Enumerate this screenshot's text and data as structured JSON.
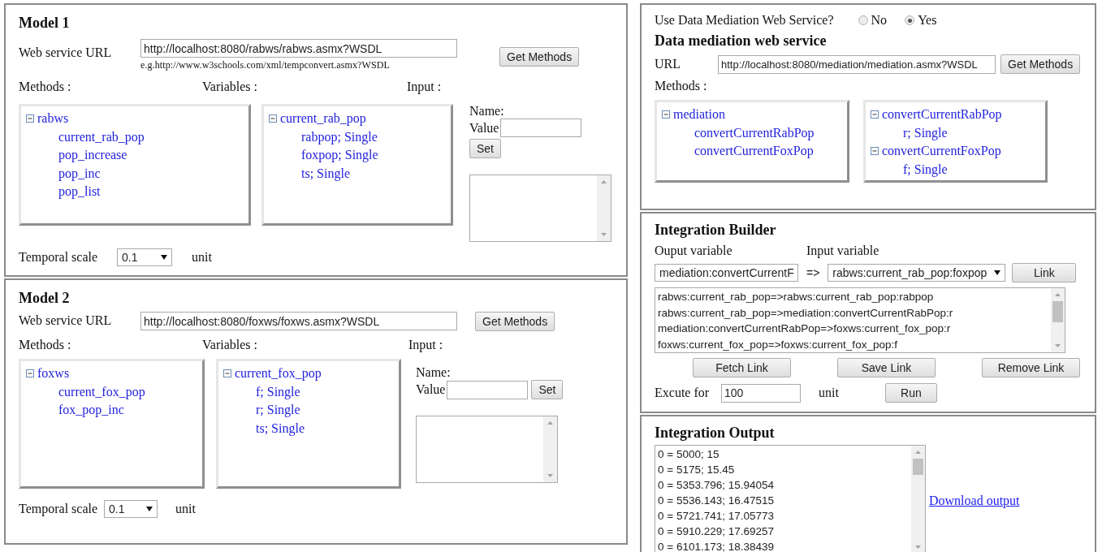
{
  "models": [
    {
      "title": "Model 1",
      "url_label": "Web service URL",
      "url": "http://localhost:8080/rabws/rabws.asmx?WSDL",
      "hint": "e.g.http://www.w3schools.com/xml/tempconvert.asmx?WSDL",
      "get_button": "Get Methods",
      "methods_label": "Methods :",
      "variables_label": "Variables :",
      "input_label": "Input :",
      "methods_tree": [
        {
          "label": "rabws",
          "expanded": true,
          "children": [
            {
              "label": "current_rab_pop"
            },
            {
              "label": "pop_increase"
            },
            {
              "label": "pop_inc"
            },
            {
              "label": "pop_list"
            }
          ]
        }
      ],
      "variables_tree": [
        {
          "label": "current_rab_pop",
          "expanded": true,
          "children": [
            {
              "label": "rabpop; Single"
            },
            {
              "label": "foxpop; Single"
            },
            {
              "label": "ts; Single"
            }
          ]
        }
      ],
      "name_label": "Name:",
      "value_label": "Value",
      "set_button": "Set",
      "temporal_label": "Temporal scale",
      "temporal_value": "0.1",
      "unit": "unit"
    },
    {
      "title": "Model 2",
      "url_label": "Web service URL",
      "url": "http://localhost:8080/foxws/foxws.asmx?WSDL",
      "get_button": "Get Methods",
      "methods_label": "Methods :",
      "variables_label": "Variables :",
      "input_label": "Input :",
      "methods_tree": [
        {
          "label": "foxws",
          "expanded": true,
          "children": [
            {
              "label": "current_fox_pop"
            },
            {
              "label": "fox_pop_inc"
            }
          ]
        }
      ],
      "variables_tree": [
        {
          "label": "current_fox_pop",
          "expanded": true,
          "children": [
            {
              "label": "f; Single"
            },
            {
              "label": "r; Single"
            },
            {
              "label": "ts; Single"
            }
          ]
        }
      ],
      "name_label": "Name:",
      "value_label": "Value",
      "set_button": "Set",
      "temporal_label": "Temporal scale",
      "temporal_value": "0.1",
      "unit": "unit"
    }
  ],
  "mediation": {
    "question": "Use Data Mediation Web Service?",
    "options": [
      {
        "label": "No",
        "selected": false
      },
      {
        "label": "Yes",
        "selected": true
      }
    ],
    "title": "Data mediation web service",
    "url_label": "URL",
    "url": "http://localhost:8080/mediation/mediation.asmx?WSDL",
    "get_button": "Get Methods",
    "methods_label": "Methods :",
    "methods_tree": [
      {
        "label": "mediation",
        "expanded": true,
        "children": [
          {
            "label": "convertCurrentRabPop"
          },
          {
            "label": "convertCurrentFoxPop"
          }
        ]
      }
    ],
    "variables_tree": [
      {
        "label": "convertCurrentRabPop",
        "expanded": true,
        "children": [
          {
            "label": "r; Single"
          }
        ]
      },
      {
        "label": "convertCurrentFoxPop",
        "expanded": true,
        "children": [
          {
            "label": "f; Single"
          }
        ]
      }
    ]
  },
  "builder": {
    "title": "Integration Builder",
    "output_label": "Ouput variable",
    "input_label": "Input variable",
    "output_value": "mediation:convertCurrentF",
    "arrow": "=>",
    "input_value": "rabws:current_rab_pop:foxpop",
    "link_button": "Link",
    "links": [
      "rabws:current_rab_pop=>rabws:current_rab_pop:rabpop",
      "rabws:current_rab_pop=>mediation:convertCurrentRabPop:r",
      "mediation:convertCurrentRabPop=>foxws:current_fox_pop:r",
      "foxws:current_fox_pop=>foxws:current_fox_pop:f"
    ],
    "buttons": [
      "Fetch Link",
      "Save Link",
      "Remove Link"
    ],
    "execute_label": "Excute for",
    "execute_value": "100",
    "unit": "unit",
    "run_button": "Run"
  },
  "output": {
    "title": "Integration Output",
    "lines": [
      "0 = 5000; 15",
      "0 = 5175; 15.45",
      "0 = 5353.796; 15.94054",
      "0 = 5536.143; 16.47515",
      "0 = 5721.741; 17.05773",
      "0 = 5910.229; 17.69257",
      "0 = 6101.173; 18.38439"
    ],
    "download_link": "Download output"
  }
}
